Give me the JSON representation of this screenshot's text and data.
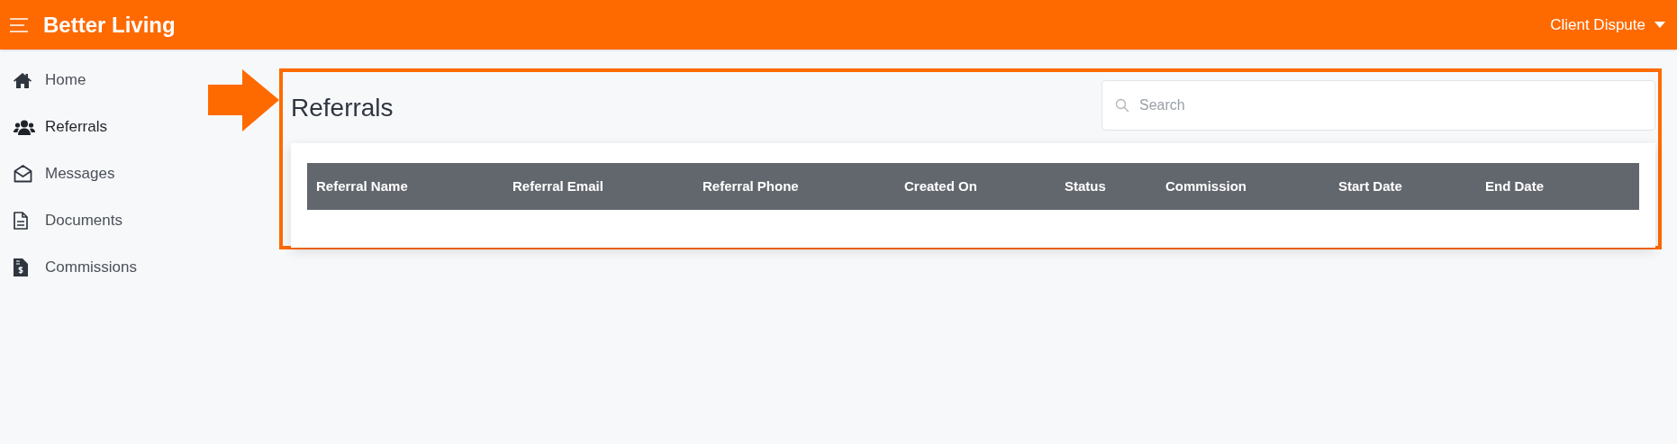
{
  "app": {
    "title": "Better Living",
    "user_menu": "Client Dispute"
  },
  "sidebar": {
    "items": [
      {
        "label": "Home",
        "selected": false
      },
      {
        "label": "Referrals",
        "selected": true
      },
      {
        "label": "Messages",
        "selected": false
      },
      {
        "label": "Documents",
        "selected": false
      },
      {
        "label": "Commissions",
        "selected": false
      }
    ]
  },
  "page": {
    "title": "Referrals"
  },
  "search": {
    "placeholder": "Search"
  },
  "table": {
    "columns": [
      "Referral Name",
      "Referral Email",
      "Referral Phone",
      "Created On",
      "Status",
      "Commission",
      "Start Date",
      "End Date"
    ]
  }
}
